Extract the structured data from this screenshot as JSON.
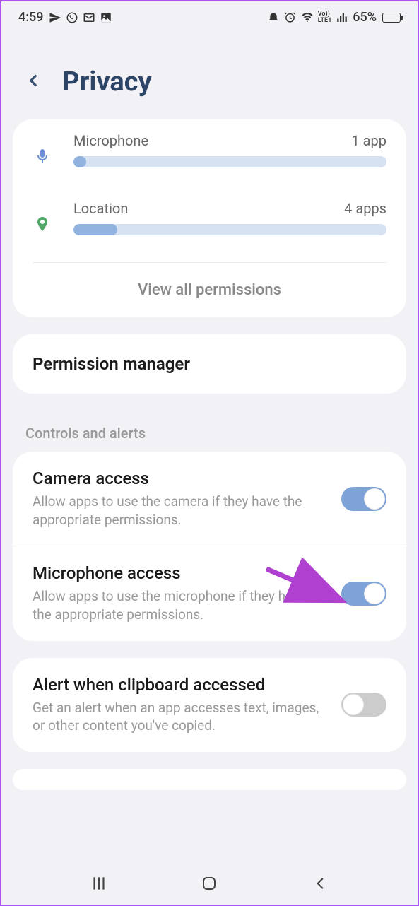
{
  "status": {
    "time": "4:59",
    "battery_pct": "65%",
    "battery_level": 65
  },
  "header": {
    "title": "Privacy"
  },
  "permissions": {
    "items": [
      {
        "name": "Microphone",
        "count": "1 app",
        "fill": 4
      },
      {
        "name": "Location",
        "count": "4 apps",
        "fill": 14
      }
    ],
    "view_all": "View all permissions"
  },
  "permission_manager": {
    "label": "Permission manager"
  },
  "controls_section": {
    "header": "Controls and alerts",
    "items": [
      {
        "title": "Camera access",
        "desc": "Allow apps to use the camera if they have the appropriate permissions.",
        "on": true
      },
      {
        "title": "Microphone access",
        "desc": "Allow apps to use the microphone if they have the appropriate permissions.",
        "on": true
      }
    ]
  },
  "clipboard": {
    "title": "Alert when clipboard accessed",
    "desc": "Get an alert when an app accesses text, images, or other content you've copied.",
    "on": false
  }
}
